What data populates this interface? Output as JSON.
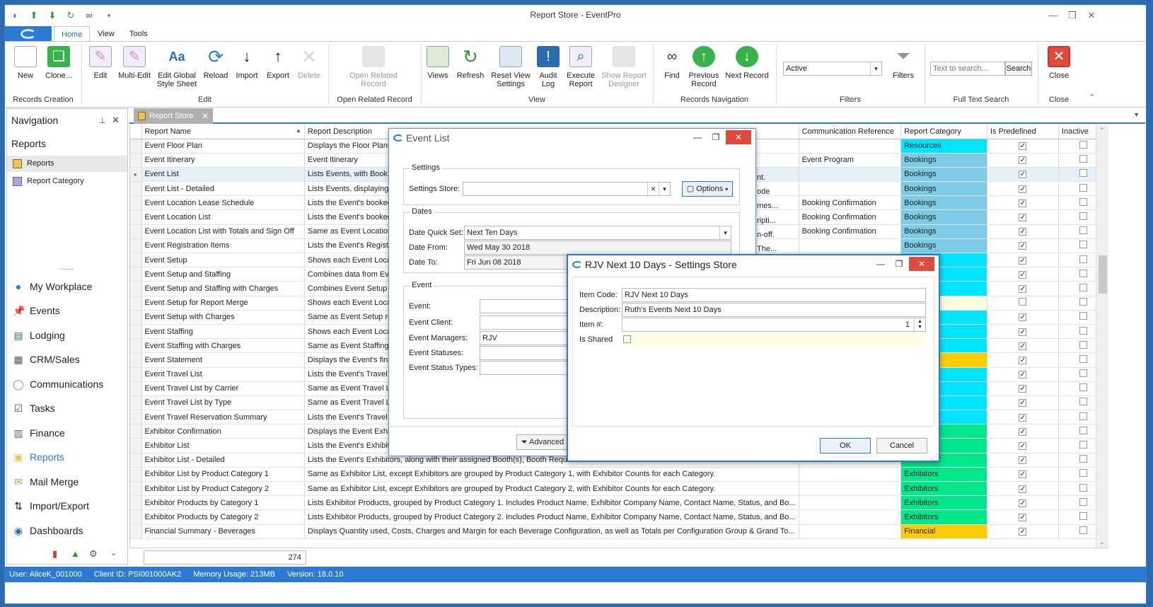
{
  "window": {
    "title": "Report Store - EventPro"
  },
  "ribbon_tabs": [
    "Home",
    "View",
    "Tools"
  ],
  "ribbon": {
    "buttons": {
      "new": "New",
      "clone": "Clone...",
      "edit": "Edit",
      "multi_edit": "Multi-Edit",
      "edit_global_1": "Edit Global",
      "edit_global_2": "Style Sheet",
      "reload": "Reload",
      "import": "Import",
      "export": "Export",
      "delete": "Delete",
      "open_related_1": "Open Related",
      "open_related_2": "Record",
      "views": "Views",
      "refresh": "Refresh",
      "reset_view_1": "Reset View",
      "reset_view_2": "Settings",
      "audit_1": "Audit",
      "audit_2": "Log",
      "execute_1": "Execute",
      "execute_2": "Report",
      "show_report_1": "Show Report",
      "show_report_2": "Designer",
      "find": "Find",
      "previous_1": "Previous",
      "previous_2": "Record",
      "next": "Next Record",
      "filters": "Filters",
      "close": "Close",
      "search": "Search"
    },
    "groups": {
      "records_creation": "Records Creation",
      "edit": "Edit",
      "open_related": "Open Related Record",
      "view": "View",
      "records_navigation": "Records Navigation",
      "filters": "Filters",
      "full_text_search": "Full Text Search",
      "close": "Close"
    },
    "filter_value": "Active",
    "search_placeholder": "Text to search..."
  },
  "navigation": {
    "title": "Navigation",
    "section": "Reports",
    "items": [
      "Reports",
      "Report Category"
    ],
    "modules": [
      "My Workplace",
      "Events",
      "Lodging",
      "CRM/Sales",
      "Communications",
      "Tasks",
      "Finance",
      "Reports",
      "Mail Merge",
      "Import/Export",
      "Dashboards"
    ]
  },
  "doc_tab": "Report Store",
  "grid": {
    "columns": [
      "Report Name",
      "Report Description",
      "Communication Reference",
      "Report Category",
      "Is Predefined",
      "Inactive"
    ],
    "rows": [
      {
        "name": "Event Floor Plan",
        "desc": "Displays the Floor Plans",
        "comm": "",
        "cat": "Resources",
        "color": "#00e5ff",
        "pre": true
      },
      {
        "name": "Event Itinerary",
        "desc": "Event Itinerary",
        "comm": "Event Program",
        "cat": "Bookings",
        "color": "#7ecbe8",
        "pre": true
      },
      {
        "name": "Event List",
        "desc": "Lists Events, with Book",
        "comm": "",
        "cat": "Bookings",
        "color": "#7ecbe8",
        "pre": true
      },
      {
        "name": "Event List - Detailed",
        "desc": "Lists Events, displaying",
        "comm": "",
        "cat": "Bookings",
        "color": "#7ecbe8",
        "pre": true
      },
      {
        "name": "Event Location Lease Schedule",
        "desc": "Lists the Event's booked",
        "comm": "Booking Confirmation",
        "cat": "Bookings",
        "color": "#7ecbe8",
        "pre": true
      },
      {
        "name": "Event Location List",
        "desc": "Lists the Event's booked",
        "comm": "Booking Confirmation",
        "cat": "Bookings",
        "color": "#7ecbe8",
        "pre": true
      },
      {
        "name": "Event Location List with Totals and Sign Off",
        "desc": "Same as Event Location",
        "comm": "Booking Confirmation",
        "cat": "Bookings",
        "color": "#7ecbe8",
        "pre": true
      },
      {
        "name": "Event Registration Items",
        "desc": "Lists the Event's Registr",
        "comm": "",
        "cat": "Bookings",
        "color": "#7ecbe8",
        "pre": true
      },
      {
        "name": "Event Setup",
        "desc": "Shows each Event Loca",
        "comm": "",
        "cat": "",
        "color": "#00e5ff",
        "pre": true
      },
      {
        "name": "Event Setup and Staffing",
        "desc": "Combines data from Eve",
        "comm": "",
        "cat": "",
        "color": "#00e5ff",
        "pre": true
      },
      {
        "name": "Event Setup and Staffing with Charges",
        "desc": "Combines Event Setup v",
        "comm": "",
        "cat": "",
        "color": "#00e5ff",
        "pre": true
      },
      {
        "name": "Event Setup for Report Merge",
        "desc": "Shows each Event Loca",
        "comm": "",
        "cat": "",
        "color": "#fffde0",
        "pre": false
      },
      {
        "name": "Event Setup with Charges",
        "desc": "Same as Event Setup re",
        "comm": "",
        "cat": "",
        "color": "#00e5ff",
        "pre": true
      },
      {
        "name": "Event Staffing",
        "desc": "Shows each Event Loca",
        "comm": "",
        "cat": "",
        "color": "#00e5ff",
        "pre": true
      },
      {
        "name": "Event Staffing with Charges",
        "desc": "Same as Event Staffing",
        "comm": "",
        "cat": "",
        "color": "#00e5ff",
        "pre": true
      },
      {
        "name": "Event Statement",
        "desc": "Displays the Event's fina",
        "comm": "",
        "cat": "",
        "color": "#ffcc00",
        "pre": true
      },
      {
        "name": "Event Travel List",
        "desc": "Lists the Event's Travel",
        "comm": "",
        "cat": "",
        "color": "#00e5ff",
        "pre": true
      },
      {
        "name": "Event Travel List by Carrier",
        "desc": "Same as Event Travel Li",
        "comm": "",
        "cat": "",
        "color": "#00e5ff",
        "pre": true
      },
      {
        "name": "Event Travel List by Type",
        "desc": "Same as Event Travel Li",
        "comm": "",
        "cat": "",
        "color": "#00e5ff",
        "pre": true
      },
      {
        "name": "Event Travel Reservation Summary",
        "desc": "Lists the Event's Travel",
        "comm": "",
        "cat": "",
        "color": "#00e5ff",
        "pre": true
      },
      {
        "name": "Exhibitor Confirmation",
        "desc": "Displays the Event Exhil",
        "comm": "",
        "cat": "",
        "color": "#00e68a",
        "pre": true
      },
      {
        "name": "Exhibitor List",
        "desc": "Lists the Event's Exhibit",
        "comm": "",
        "cat": "",
        "color": "#00e68a",
        "pre": true
      },
      {
        "name": "Exhibitor List - Detailed",
        "desc": "Lists the Event's Exhibitors, along with their assigned Booth(s), Booth Require",
        "comm": "",
        "cat": "",
        "color": "#00e68a",
        "pre": true
      },
      {
        "name": "Exhibitor List by Product Category 1",
        "desc": "Same as Exhibitor List, except Exhibitors are grouped by Product Category 1, with Exhibitor Counts for each Category.",
        "comm": "",
        "cat": "Exhibitors",
        "color": "#00e68a",
        "pre": true
      },
      {
        "name": "Exhibitor List by Product Category 2",
        "desc": "Same as Exhibitor List, except Exhibitors are grouped by Product Category 2, with Exhibitor Counts for each Category.",
        "comm": "",
        "cat": "Exhibitors",
        "color": "#00e68a",
        "pre": true
      },
      {
        "name": "Exhibitor Products by Category 1",
        "desc": "Lists Exhibitor Products, grouped by Product Category 1. Includes Product Name, Exhibitor Company Name, Contact Name, Status, and Bo...",
        "comm": "",
        "cat": "Exhibitors",
        "color": "#00e68a",
        "pre": true
      },
      {
        "name": "Exhibitor Products by Category 2",
        "desc": "Lists Exhibitor Products, grouped by Product Category 2. Includes Product Name, Exhibitor Company Name, Contact Name, Status, and Bo...",
        "comm": "",
        "cat": "Exhibitors",
        "color": "#00e68a",
        "pre": true
      },
      {
        "name": "Financial Summary - Beverages",
        "desc": "Displays Quantity used, Costs, Charges and Margin for each Beverage Configuration, as well as Totals per Configuration Group & Grand To...",
        "comm": "",
        "cat": "Financial",
        "color": "#ffcc00",
        "pre": true
      }
    ],
    "record_count": "274"
  },
  "event_list_dialog": {
    "title": "Event List",
    "settings_group": "Settings",
    "settings_store_label": "Settings Store:",
    "options_label": "Options",
    "dates_group": "Dates",
    "date_quick_set_label": "Date Quick Set:",
    "date_quick_set_value": "Next Ten Days",
    "date_from_label": "Date From:",
    "date_from_value": "Wed May 30 2018",
    "date_to_label": "Date To:",
    "date_to_value": "Fri Jun 08 2018",
    "event_group": "Event",
    "event_label": "Event:",
    "event_client_label": "Event Client:",
    "event_managers_label": "Event Managers:",
    "event_managers_value": "RJV",
    "event_statuses_label": "Event Statuses:",
    "event_status_types_label": "Event Status Types:",
    "advanced_label": "Advanced",
    "peek_text": [
      "nt.",
      "ode",
      "mes...",
      "ripti...",
      "n-off.",
      "The..."
    ]
  },
  "settings_store_dialog": {
    "title": "RJV Next 10 Days - Settings Store",
    "item_code_label": "Item Code:",
    "item_code_value": "RJV Next 10 Days",
    "description_label": "Description:",
    "description_value": "Ruth's Events Next 10 Days",
    "item_num_label": "Item #:",
    "item_num_value": "1",
    "is_shared_label": "Is Shared",
    "ok_label": "OK",
    "cancel_label": "Cancel"
  },
  "status_bar": {
    "user": "User: AliceK_001000",
    "client": "Client ID: PSI001000AK2",
    "memory": "Memory Usage: 213MB",
    "version": "Version: 18.0.10"
  }
}
